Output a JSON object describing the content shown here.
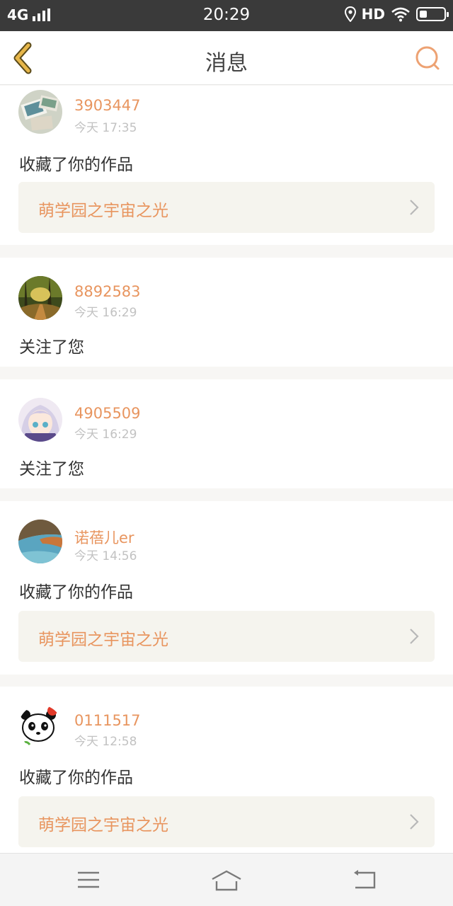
{
  "status_bar": {
    "network": "4G",
    "time": "20:29",
    "hd": "HD",
    "icons": [
      "signal-icon",
      "location-icon",
      "wifi-icon",
      "battery-icon"
    ],
    "battery_level": 0.3
  },
  "nav": {
    "title": "消息",
    "back_icon": "chevron-left-icon",
    "search_icon": "search-icon"
  },
  "messages": [
    {
      "user": "3903447",
      "time": "今天 17:35",
      "action": "收藏了你的作品",
      "work": "萌学园之宇宙之光"
    },
    {
      "user": "8892583",
      "time": "今天 16:29",
      "action": "关注了您"
    },
    {
      "user": "4905509",
      "time": "今天 16:29",
      "action": "关注了您"
    },
    {
      "user": "诺蓓儿er",
      "time": "今天 14:56",
      "action": "收藏了你的作品",
      "work": "萌学园之宇宙之光"
    },
    {
      "user": "0111517",
      "time": "今天 12:58",
      "action": "收藏了你的作品",
      "work": "萌学园之宇宙之光"
    }
  ],
  "bottom_nav": {
    "icons": [
      "menu-icon",
      "home-icon",
      "back-icon"
    ]
  },
  "colors": {
    "accent": "#e8955f",
    "back_arrow": "#e6b64a",
    "status_bar_bg": "#3a3a3a",
    "work_card_bg": "#f5f4ee"
  }
}
